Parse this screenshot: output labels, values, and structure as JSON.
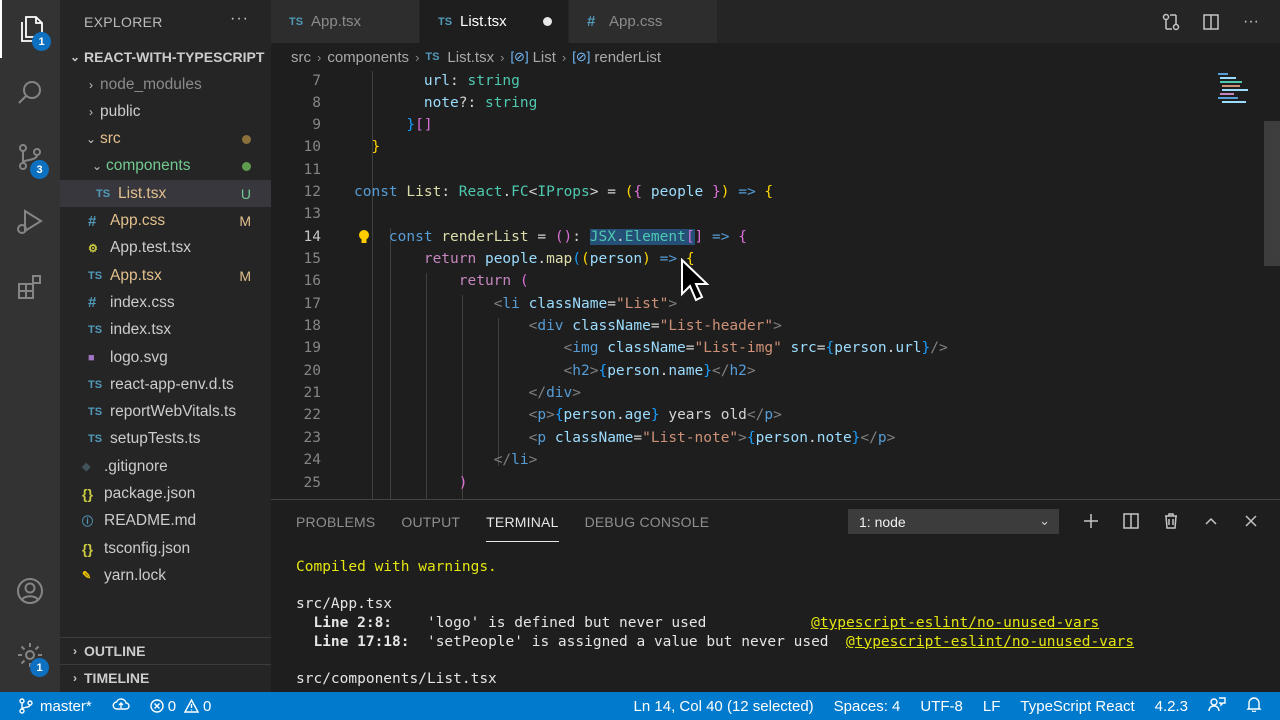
{
  "activity_bar": {
    "explorer_badge": "1",
    "scm_badge": "3",
    "settings_badge": "1"
  },
  "sidebar": {
    "title": "EXPLORER",
    "more": "···",
    "project": "REACT-WITH-TYPESCRIPT",
    "tree": [
      {
        "label": "node_modules",
        "kind": "folder",
        "open": false,
        "indent": 1,
        "color": "#8b8b8b"
      },
      {
        "label": "public",
        "kind": "folder",
        "open": false,
        "indent": 1,
        "color": "#cccccc"
      },
      {
        "label": "src",
        "kind": "folder",
        "open": true,
        "indent": 1,
        "color": "#e2c08d",
        "dot": "#8b6f3b"
      },
      {
        "label": "components",
        "kind": "folder",
        "open": true,
        "indent": 2,
        "color": "#73c991",
        "dot": "#5f9b4d"
      },
      {
        "label": "List.tsx",
        "kind": "ts",
        "indent": 3,
        "color": "#e2c08d",
        "git": "U",
        "git_color": "#73c991",
        "selected": true
      },
      {
        "label": "App.css",
        "kind": "css",
        "indent": 2,
        "color": "#e2c08d",
        "git": "M",
        "git_color": "#e2c08d"
      },
      {
        "label": "App.test.tsx",
        "kind": "test",
        "indent": 2,
        "color": "#cccccc"
      },
      {
        "label": "App.tsx",
        "kind": "ts",
        "indent": 2,
        "color": "#e2c08d",
        "git": "M",
        "git_color": "#e2c08d"
      },
      {
        "label": "index.css",
        "kind": "css",
        "indent": 2,
        "color": "#cccccc"
      },
      {
        "label": "index.tsx",
        "kind": "ts",
        "indent": 2,
        "color": "#cccccc"
      },
      {
        "label": "logo.svg",
        "kind": "svg",
        "indent": 2,
        "color": "#cccccc"
      },
      {
        "label": "react-app-env.d.ts",
        "kind": "ts",
        "indent": 2,
        "color": "#cccccc"
      },
      {
        "label": "reportWebVitals.ts",
        "kind": "ts",
        "indent": 2,
        "color": "#cccccc"
      },
      {
        "label": "setupTests.ts",
        "kind": "ts",
        "indent": 2,
        "color": "#cccccc"
      },
      {
        "label": ".gitignore",
        "kind": "git",
        "indent": 1,
        "color": "#cccccc"
      },
      {
        "label": "package.json",
        "kind": "json",
        "indent": 1,
        "color": "#cccccc"
      },
      {
        "label": "README.md",
        "kind": "info",
        "indent": 1,
        "color": "#cccccc"
      },
      {
        "label": "tsconfig.json",
        "kind": "json",
        "indent": 1,
        "color": "#cccccc"
      },
      {
        "label": "yarn.lock",
        "kind": "yarn",
        "indent": 1,
        "color": "#cccccc"
      }
    ],
    "outline": "OUTLINE",
    "timeline": "TIMELINE"
  },
  "tabs": [
    {
      "label": "App.tsx",
      "icon": "TS",
      "active": false
    },
    {
      "label": "List.tsx",
      "icon": "TS",
      "active": true,
      "dirty": true
    },
    {
      "label": "App.css",
      "icon": "#",
      "active": false
    }
  ],
  "breadcrumb": [
    "src",
    "components",
    "List.tsx",
    "List",
    "renderList"
  ],
  "editor": {
    "line_numbers": [
      "7",
      "8",
      "9",
      "10",
      "11",
      "12",
      "13",
      "14",
      "15",
      "16",
      "17",
      "18",
      "19",
      "20",
      "21",
      "22",
      "23",
      "24",
      "25"
    ]
  },
  "panel": {
    "tabs": [
      "PROBLEMS",
      "OUTPUT",
      "TERMINAL",
      "DEBUG CONSOLE"
    ],
    "active_tab": "TERMINAL",
    "terminal_select": "1: node",
    "terminal": {
      "compiled": "Compiled with warnings.",
      "file1": "src/App.tsx",
      "w1_loc": "Line 2:8:",
      "w1_msg": "'logo' is defined but never used",
      "w1_rule": "@typescript-eslint/no-unused-vars",
      "w2_loc": "Line 17:18:",
      "w2_msg": "'setPeople' is assigned a value but never used",
      "w2_rule": "@typescript-eslint/no-unused-vars",
      "file2": "src/components/List.tsx"
    }
  },
  "statusbar": {
    "branch": "master*",
    "errors": "0",
    "warnings": "0",
    "position": "Ln 14, Col 40 (12 selected)",
    "spaces": "Spaces: 4",
    "encoding": "UTF-8",
    "eol": "LF",
    "language": "TypeScript React",
    "version": "4.2.3"
  },
  "colors": {
    "accent": "#007acc",
    "selection": "#264f78"
  }
}
